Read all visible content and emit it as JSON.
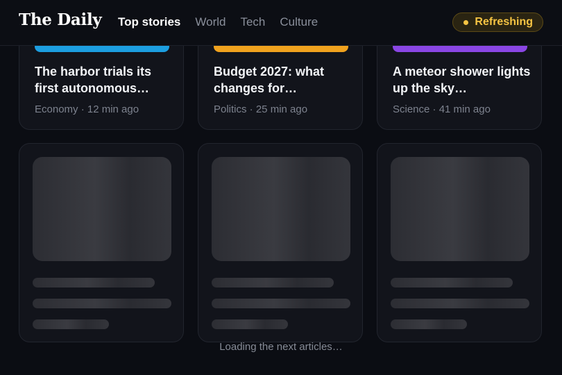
{
  "header": {
    "brand": "The Daily",
    "nav": [
      {
        "label": "Top stories",
        "active": true
      },
      {
        "label": "World",
        "active": false
      },
      {
        "label": "Tech",
        "active": false
      },
      {
        "label": "Culture",
        "active": false
      }
    ],
    "status": {
      "label": "Refreshing",
      "color": "#f6c443"
    }
  },
  "articles": [
    {
      "headline": "The harbor trials its first autonomous…",
      "meta": "Economy · 12 min ago",
      "accent": "#1c9ee0"
    },
    {
      "headline": "Budget 2027: what changes for…",
      "meta": "Politics · 25 min ago",
      "accent": "#f0a21e"
    },
    {
      "headline": "A meteor shower lights up the sky…",
      "meta": "Science · 41 min ago",
      "accent": "#8a46e4"
    }
  ],
  "loading": {
    "text": "Loading the next articles…"
  }
}
